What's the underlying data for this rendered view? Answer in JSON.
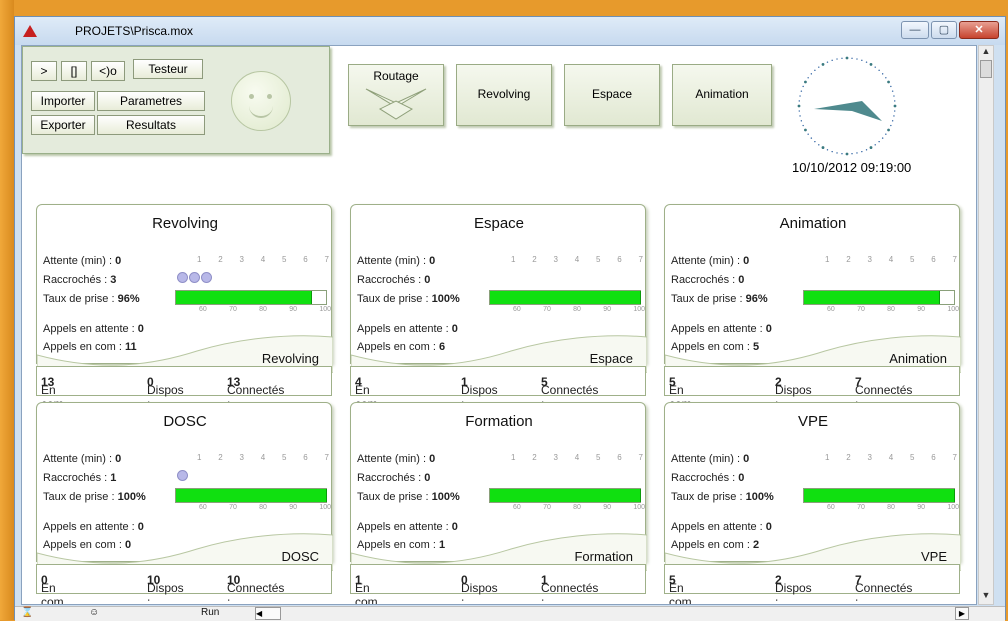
{
  "window": {
    "title": "PROJETS\\Prisca.mox",
    "min": "—",
    "max": "▢",
    "close": "✕"
  },
  "toolbar": {
    "btn_play": ">",
    "btn_stop": "[]",
    "btn_sound": "<)o",
    "btn_testeur": "Testeur",
    "btn_importer": "Importer",
    "btn_parametres": "Parametres",
    "btn_exporter": "Exporter",
    "btn_resultats": "Resultats"
  },
  "nav": {
    "routage": "Routage",
    "revolving": "Revolving",
    "espace": "Espace",
    "animation": "Animation"
  },
  "datetime": "10/10/2012 09:19:00",
  "labels": {
    "attente": "Attente (min)  :",
    "raccroches": "Raccrochés  :",
    "taux": "Taux de prise :",
    "appels_attente": "Appels en attente :",
    "appels_com": "Appels en com    :",
    "en_com": "En com :",
    "dispos": "Dispos :",
    "connectes": "Connectés :"
  },
  "scale_top": [
    "1",
    "2",
    "3",
    "4",
    "5",
    "6",
    "7"
  ],
  "scale_bar": [
    "60",
    "70",
    "80",
    "90",
    "100"
  ],
  "cards": [
    {
      "title": "Revolving",
      "attente": "0",
      "raccroches": "3",
      "faces": 3,
      "taux": "96%",
      "taux_fraction": 0.9,
      "appels_attente": "0",
      "appels_com": "11",
      "group": "Revolving",
      "en_com": "13",
      "dispos": "0",
      "connectes": "13"
    },
    {
      "title": "Espace",
      "attente": "0",
      "raccroches": "0",
      "faces": 0,
      "taux": "100%",
      "taux_fraction": 1.0,
      "appels_attente": "0",
      "appels_com": "6",
      "group": "Espace",
      "en_com": "4",
      "dispos": "1",
      "connectes": "5"
    },
    {
      "title": "Animation",
      "attente": "0",
      "raccroches": "0",
      "faces": 0,
      "taux": "96%",
      "taux_fraction": 0.9,
      "appels_attente": "0",
      "appels_com": "5",
      "group": "Animation",
      "en_com": "5",
      "dispos": "2",
      "connectes": "7"
    },
    {
      "title": "DOSC",
      "attente": "0",
      "raccroches": "1",
      "faces": 1,
      "taux": "100%",
      "taux_fraction": 1.0,
      "appels_attente": "0",
      "appels_com": "0",
      "group": "DOSC",
      "en_com": "0",
      "dispos": "10",
      "connectes": "10"
    },
    {
      "title": "Formation",
      "attente": "0",
      "raccroches": "0",
      "faces": 0,
      "taux": "100%",
      "taux_fraction": 1.0,
      "appels_attente": "0",
      "appels_com": "1",
      "group": "Formation",
      "en_com": "1",
      "dispos": "0",
      "connectes": "1"
    },
    {
      "title": "VPE",
      "attente": "0",
      "raccroches": "0",
      "faces": 0,
      "taux": "100%",
      "taux_fraction": 1.0,
      "appels_attente": "0",
      "appels_com": "2",
      "group": "VPE",
      "en_com": "5",
      "dispos": "2",
      "connectes": "7"
    }
  ],
  "status": {
    "hourglass": "⌛",
    "smiley": "☺",
    "run": "Run"
  },
  "colors": {
    "bar": "#10e010",
    "panel": "#e4ebdc",
    "orange": "#e79a2c"
  }
}
